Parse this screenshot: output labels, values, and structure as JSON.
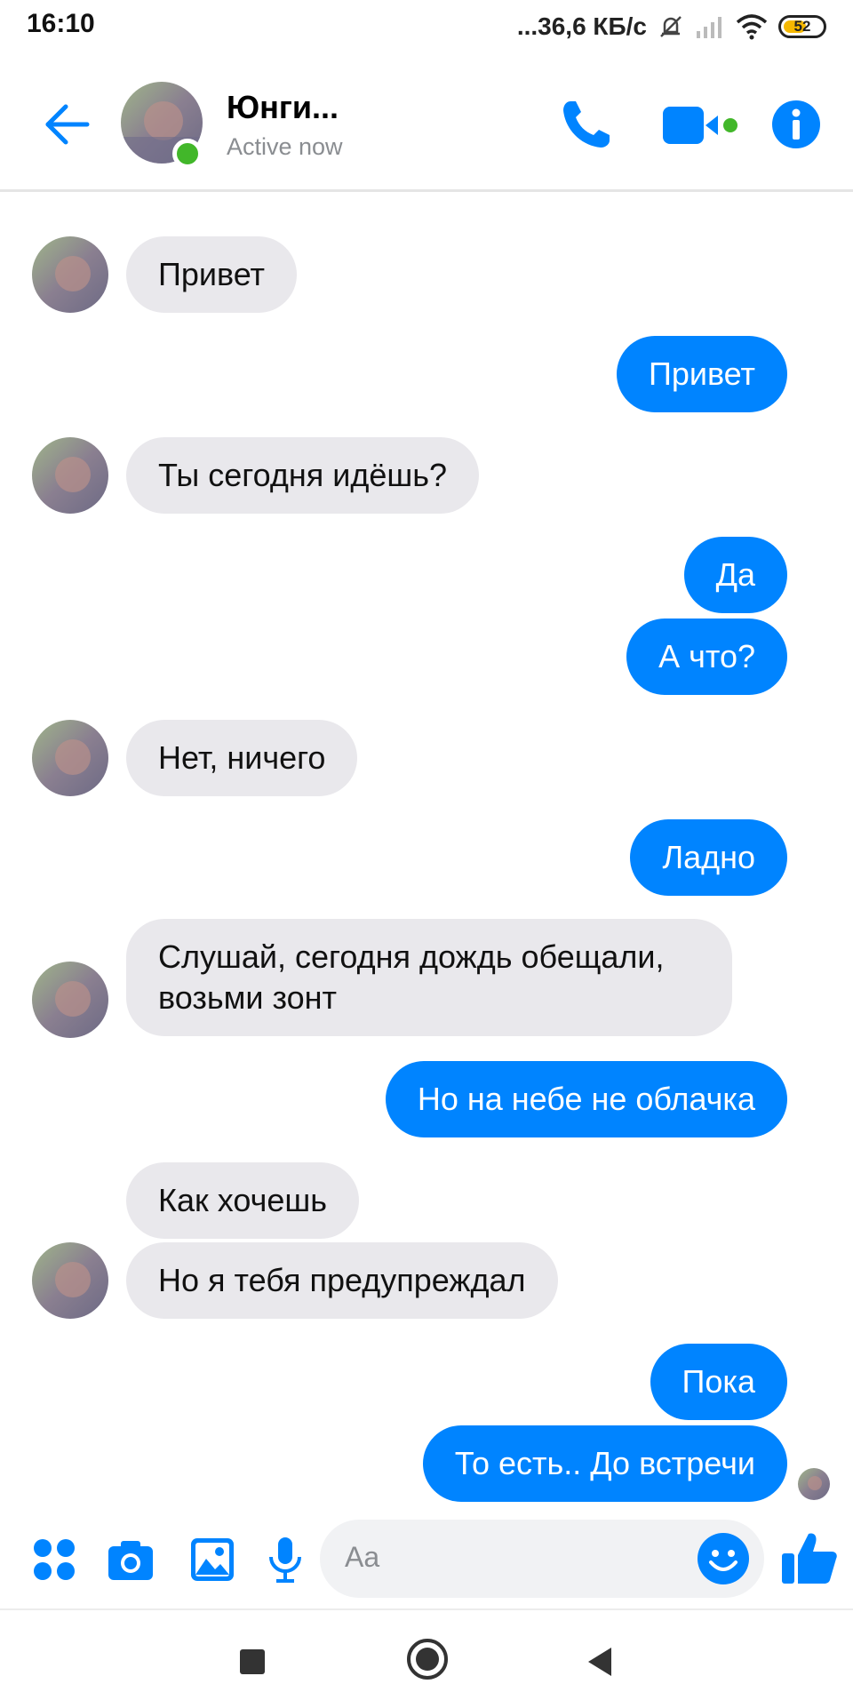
{
  "status_bar": {
    "time": "16:10",
    "network_speed": "...36,6 КБ/с",
    "battery": "52",
    "icons": [
      "silent-bell-icon",
      "signal-icon",
      "wifi-icon",
      "battery-icon"
    ]
  },
  "header": {
    "contact_name": "Юнги...",
    "contact_status": "Active now",
    "icons": [
      "back-arrow-icon",
      "phone-icon",
      "video-camera-icon",
      "info-icon"
    ]
  },
  "messages": [
    {
      "from": "them",
      "text": "Привет"
    },
    {
      "from": "me",
      "text": "Привет"
    },
    {
      "from": "them",
      "text": "Ты сегодня идёшь?"
    },
    {
      "from": "me",
      "text": "Да"
    },
    {
      "from": "me",
      "text": "А что?"
    },
    {
      "from": "them",
      "text": "Нет, ничего"
    },
    {
      "from": "me",
      "text": "Ладно"
    },
    {
      "from": "them",
      "text": "Слушай, сегодня дождь обещали, возьми зонт"
    },
    {
      "from": "me",
      "text": "Но на небе не облачка"
    },
    {
      "from": "them",
      "text": "Как хочешь"
    },
    {
      "from": "them",
      "text": "Но я тебя предупреждал"
    },
    {
      "from": "me",
      "text": "Пока"
    },
    {
      "from": "me",
      "text": "То есть.. До встречи"
    }
  ],
  "composer": {
    "placeholder": "Aa",
    "icons": [
      "apps-grid-icon",
      "camera-icon",
      "gallery-icon",
      "microphone-icon",
      "emoji-icon",
      "thumbs-up-icon"
    ]
  },
  "navigation": {
    "icons": [
      "recents-square-icon",
      "home-circle-icon",
      "back-triangle-icon"
    ]
  },
  "colors": {
    "accent": "#0084ff",
    "incoming_bubble": "#e9e8ec",
    "online": "#42b72a"
  }
}
